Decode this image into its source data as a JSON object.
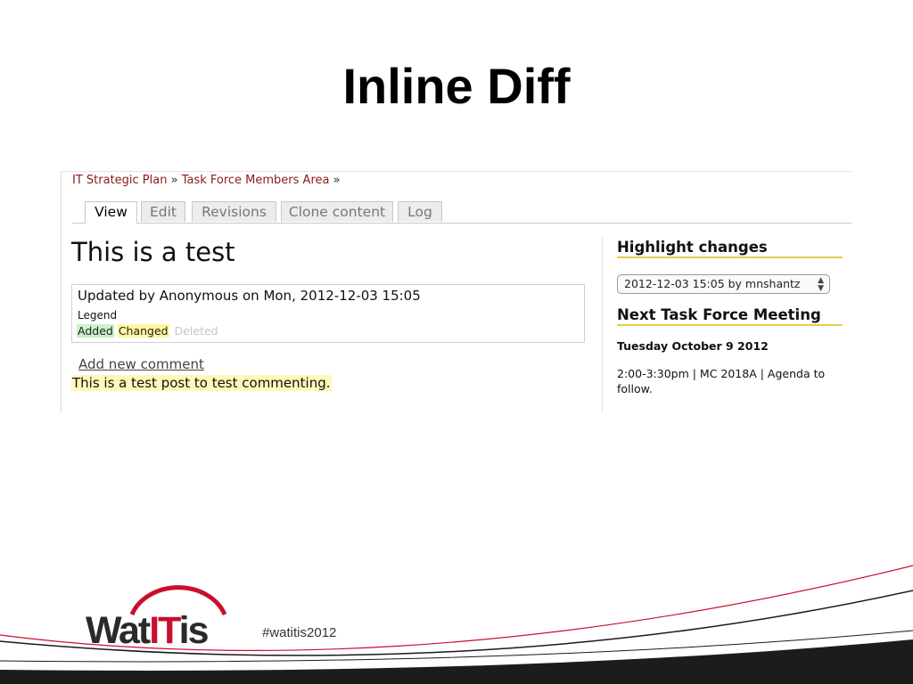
{
  "slide": {
    "title": "Inline Diff"
  },
  "breadcrumb": {
    "item1": "IT Strategic Plan",
    "sep1": " » ",
    "item2": "Task Force Members Area",
    "sep2": " »"
  },
  "tabs": {
    "view": "View",
    "edit": "Edit",
    "revisions": "Revisions",
    "clone": "Clone content",
    "log": "Log"
  },
  "node": {
    "title": "This is a test",
    "updated": "Updated by Anonymous on Mon, 2012-12-03 15:05",
    "legend": {
      "label": "Legend",
      "added": "Added",
      "changed": "Changed",
      "deleted": "Deleted"
    }
  },
  "comments": {
    "add_link": "Add new comment",
    "text": "This is a test post to test commenting."
  },
  "sidebar": {
    "highlight_title": "Highlight changes",
    "revision_selected": "2012-12-03 15:05 by mnshantz",
    "meeting_title": "Next Task Force Meeting",
    "meeting_date": "Tuesday October 9 2012",
    "meeting_info": "2:00-3:30pm | MC 2018A | Agenda to follow."
  },
  "footer": {
    "logo_wat": "Wat",
    "logo_it": "IT",
    "logo_is": "is",
    "hashtag": "#watitis2012"
  },
  "colors": {
    "link": "#8b1a1a",
    "added_bg": "#c8f2c8",
    "changed_bg": "#fff6a0",
    "block_underline": "#e6cc4a",
    "logo_red": "#c8102e"
  }
}
